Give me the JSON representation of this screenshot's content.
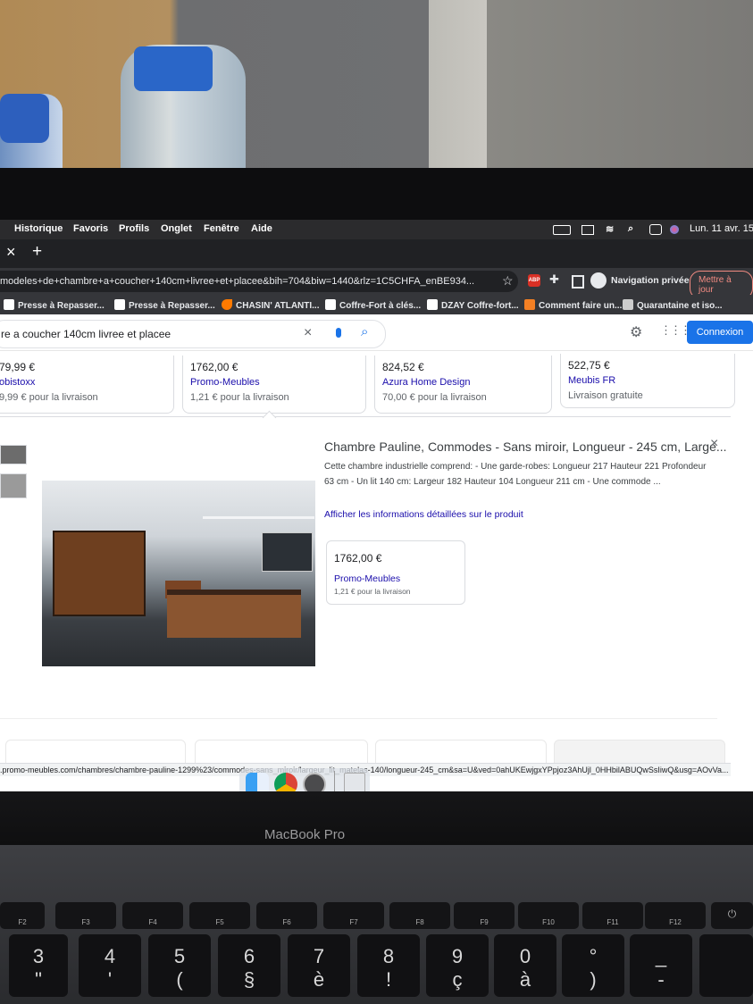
{
  "menubar": {
    "items": [
      "Historique",
      "Favoris",
      "Profils",
      "Onglet",
      "Fenêtre",
      "Aide"
    ],
    "clock": "Lun. 11 avr. 15:"
  },
  "tabbar": {
    "close": "×",
    "new_tab": "+"
  },
  "urlbar": {
    "url": "modeles+de+chambre+a+coucher+140cm+livree+et+placee&bih=704&biw=1440&rlz=1C5CHFA_enBE934...",
    "abp": "ABP",
    "profile": "Navigation privée",
    "update": "Mettre à jour"
  },
  "bookmarks": [
    {
      "label": "Presse à Repasser...",
      "icon": "amazon-icon"
    },
    {
      "label": "Presse à Repasser...",
      "icon": "amazon-icon"
    },
    {
      "label": "CHASIN' ATLANTI...",
      "icon": "play-icon"
    },
    {
      "label": "Coffre-Fort à clés...",
      "icon": "amazon-icon"
    },
    {
      "label": "DZAY Coffre-fort...",
      "icon": "amazon-icon"
    },
    {
      "label": "Comment faire un...",
      "icon": "stack-icon"
    },
    {
      "label": "Quarantaine et iso...",
      "icon": "site-icon"
    }
  ],
  "search": {
    "query": "re a coucher 140cm livree et placee",
    "signin": "Connexion"
  },
  "offers": [
    {
      "price": "79,99 €",
      "store": "obistoxx",
      "shipping": "9,99 € pour la livraison"
    },
    {
      "price": "1762,00 €",
      "store": "Promo-Meubles",
      "shipping": "1,21 € pour la livraison"
    },
    {
      "price": "824,52 €",
      "store": "Azura Home Design",
      "shipping": "70,00 € pour la livraison"
    },
    {
      "price": "522,75 €",
      "store": "Meubis FR",
      "shipping": "Livraison gratuite"
    }
  ],
  "product": {
    "title": "Chambre Pauline, Commodes - Sans miroir, Longueur - 245 cm, Large...",
    "description": "Cette chambre industrielle comprend: - Une garde-robes: Longueur 217 Hauteur 221 Profondeur 63 cm - Un lit 140 cm: Largeur 182 Hauteur 104 Longueur 211 cm - Une commode ...",
    "details_link": "Afficher les informations détaillées sur le produit",
    "offer": {
      "price": "1762,00 €",
      "store": "Promo-Meubles",
      "shipping": "1,21 € pour la livraison"
    },
    "close": "×"
  },
  "status_url": ".promo-meubles.com/chambres/chambre-pauline-1299%23/commodes-sans_miroir/largeur_lit_matelas-140/longueur-245_cm&sa=U&ved=0ahUKEwjgxYPpjoz3AhUjl_0HHbilABUQwSsIiwQ&usg=AOvVa...",
  "laptop": {
    "brand": "MacBook Pro",
    "fkeys": [
      "F2",
      "F3",
      "F4",
      "F5",
      "F6",
      "F7",
      "F8",
      "F9",
      "F10",
      "F11",
      "F12"
    ],
    "keys": [
      {
        "top": "3",
        "bottom": "\""
      },
      {
        "top": "4",
        "bottom": "'"
      },
      {
        "top": "5",
        "bottom": "("
      },
      {
        "top": "6",
        "bottom": "§"
      },
      {
        "top": "7",
        "bottom": "è"
      },
      {
        "top": "8",
        "bottom": "!"
      },
      {
        "top": "9",
        "bottom": "ç"
      },
      {
        "top": "0",
        "bottom": "à"
      },
      {
        "top": "°",
        "bottom": ")"
      },
      {
        "top": "_",
        "bottom": "-"
      }
    ]
  },
  "colors": {
    "link": "#1a0dab",
    "signin_bg": "#1a73e8",
    "dark_chrome": "#35363a"
  }
}
